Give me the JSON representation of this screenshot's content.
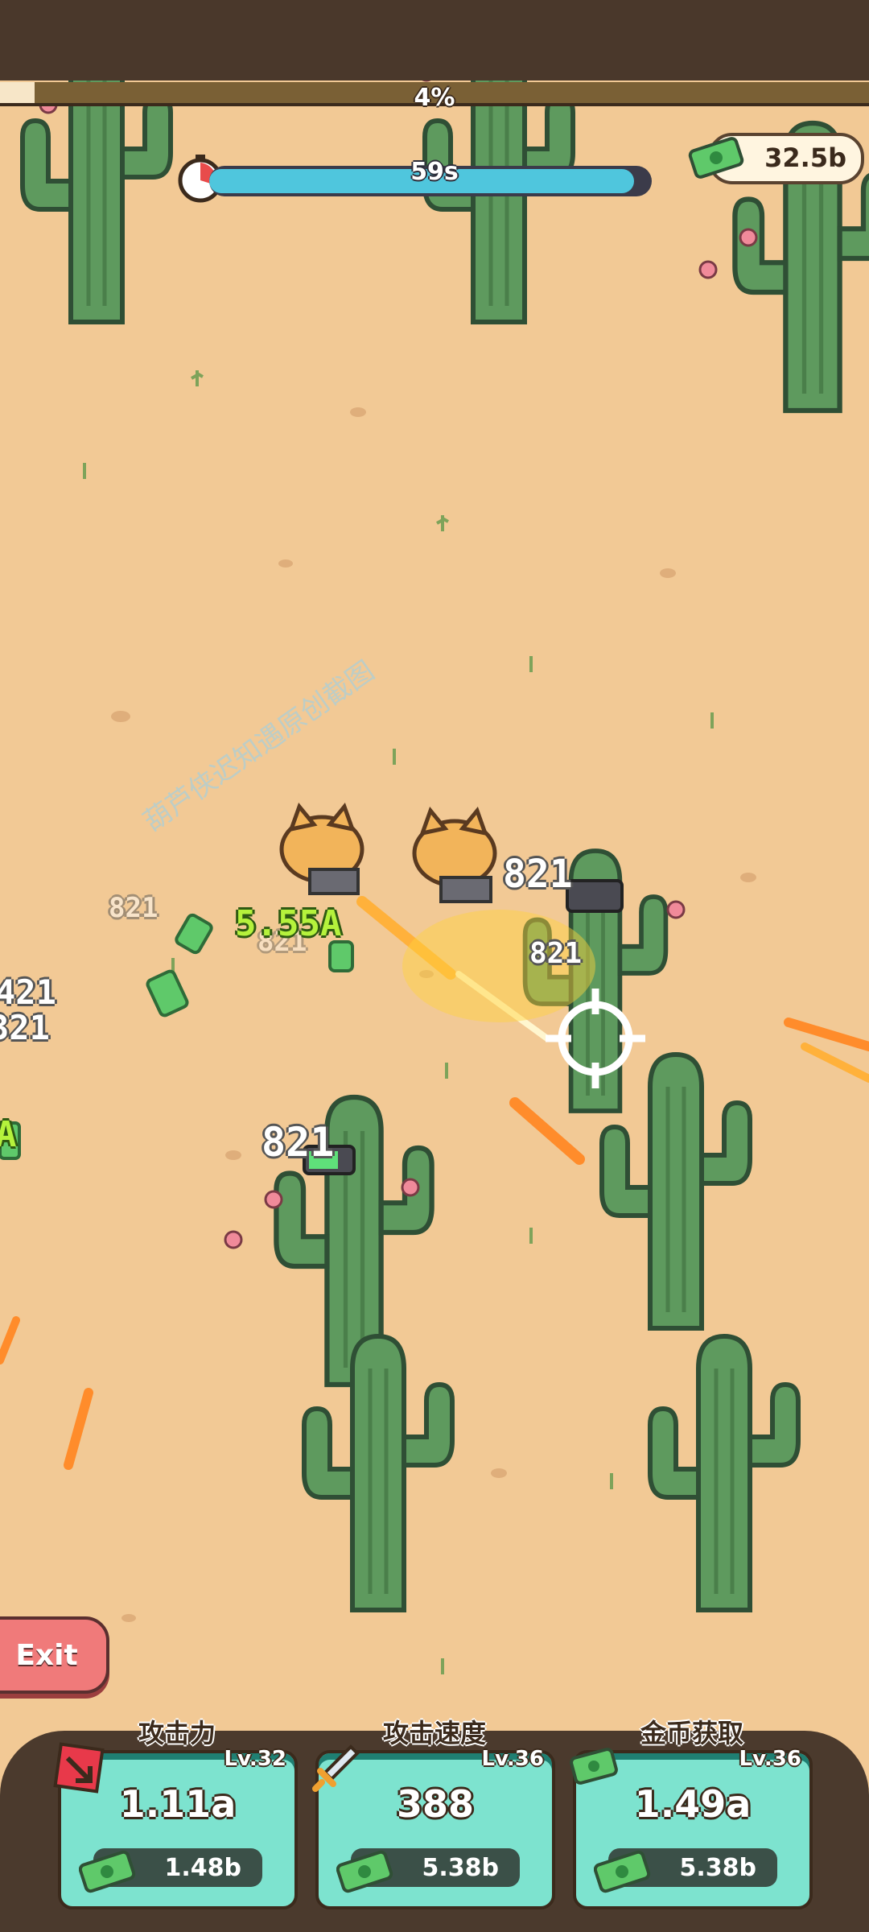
{
  "hud": {
    "progress_percent": 4,
    "progress_label": "4%",
    "timer_label": "59s",
    "timer_fraction": 0.96,
    "money": "32.5b"
  },
  "floating_text": {
    "damage_numbers": [
      "821",
      "821",
      "821",
      "821",
      "821",
      "421",
      "321"
    ],
    "coin_gain": "5.55A",
    "coin_gain_partial": "A"
  },
  "exit_label": "Exit",
  "upgrades": [
    {
      "title": "攻击力",
      "level": "Lv.32",
      "value": "1.11a",
      "cost": "1.48b",
      "icon": "attack-icon"
    },
    {
      "title": "攻击速度",
      "level": "Lv.36",
      "value": "388",
      "cost": "5.38b",
      "icon": "sword-icon"
    },
    {
      "title": "金币获取",
      "level": "Lv.36",
      "value": "1.49a",
      "cost": "5.38b",
      "icon": "cash-icon"
    }
  ],
  "watermark": "葫芦侠迟知遇原创截图",
  "colors": {
    "sand": "#f2c995",
    "card": "#7de3cf",
    "timer": "#4fc6dd",
    "exit": "#f07a7a"
  }
}
